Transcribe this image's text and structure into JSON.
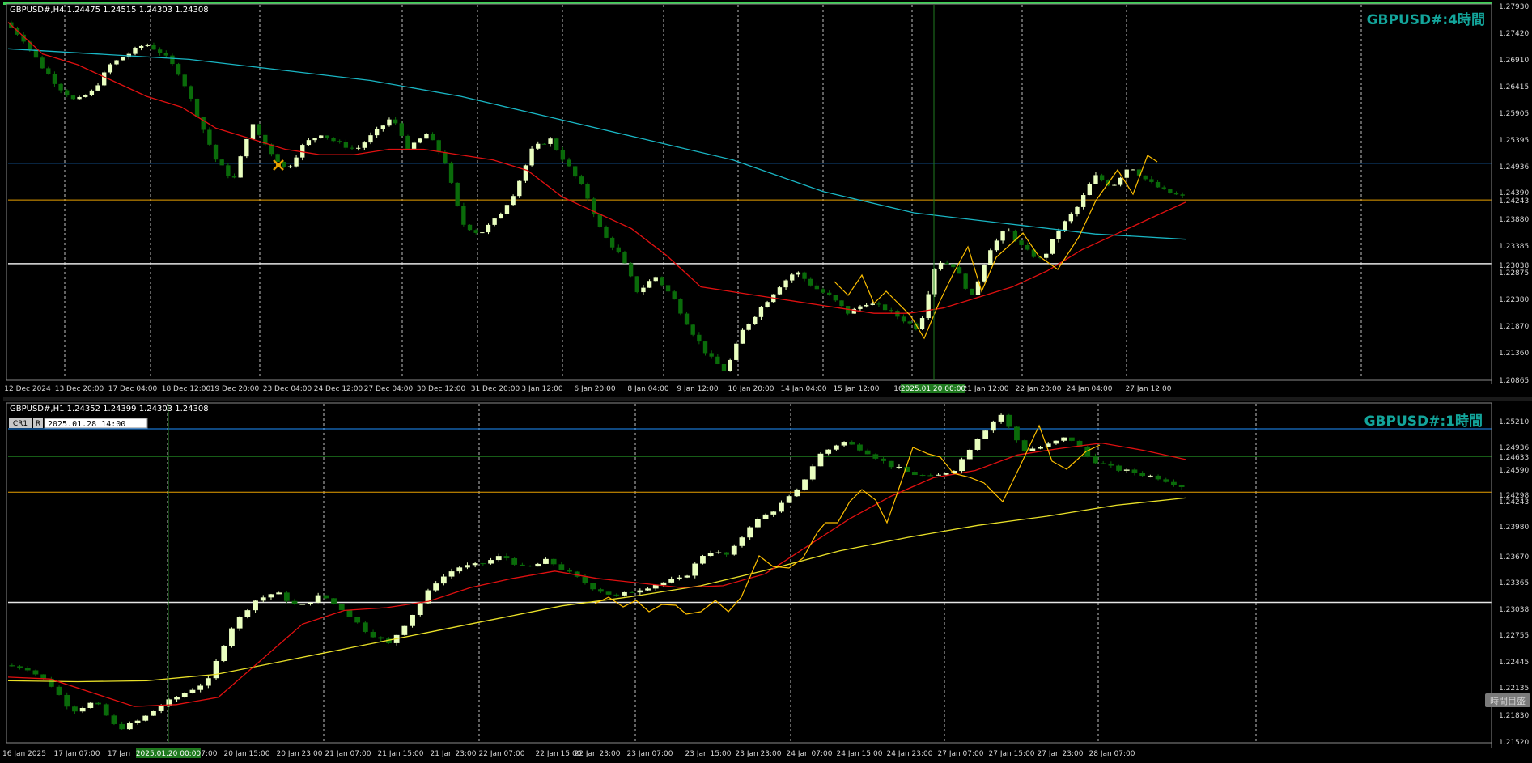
{
  "colors": {
    "background": "#000000",
    "frame": "#c0c0c0",
    "grid": "#c0c0c0",
    "bull_candle": "#eaffc0",
    "bear_candle": "#0a6b0a",
    "ma_short": "#e01010",
    "ma_long_h4": "#19b6c4",
    "ma_long_h1": "#e9e028",
    "zigzag": "#ffc000",
    "level_blue": "#1e90ff",
    "level_orange": "#e8a000",
    "level_white": "#e6e6e6",
    "level_green": "#1f7a1f",
    "watermark": "#13a59b",
    "top_bar": "#39d353"
  },
  "h4": {
    "info": "GBPUSD#,H4  1.24475 1.24515 1.24303 1.24308",
    "watermark": "GBPUSD#:4時間",
    "price_labels": [
      "1.27930",
      "1.27420",
      "1.26910",
      "1.26415",
      "1.25905",
      "1.25395",
      "1.24936",
      "1.24390",
      "1.24243",
      "1.23880",
      "1.23385",
      "1.23038",
      "1.22875",
      "1.22380",
      "1.21870",
      "1.21360",
      "1.20865"
    ],
    "date_labels": [
      "12 Dec 2024",
      "13 Dec 20:00",
      "17 Dec 04:00",
      "18 Dec 12:00",
      "19 Dec 20:00",
      "23 Dec 04:00",
      "24 Dec 12:00",
      "27 Dec 04:00",
      "30 Dec 12:00",
      "31 Dec 20:00",
      "3 Jan 12:00",
      "6 Jan 20:00",
      "8 Jan 04:00",
      "9 Jan 12:00",
      "10 Jan 20:00",
      "14 Jan 04:00",
      "15 Jan 12:00",
      "16",
      "04:00",
      "21 Jan 12:00",
      "22 Jan 20:00",
      "24 Jan 04:00",
      "27 Jan 12:00"
    ],
    "cursor_date": "2025.01.20 00:00",
    "level_blue": "1.24936",
    "level_orange": "1.24243",
    "level_white": "1.23038"
  },
  "h1": {
    "info": "GBPUSD#,H1  1.24352 1.24399 1.24303 1.24308",
    "watermark": "GBPUSD#:1時間",
    "tool_btn1": "CR1",
    "tool_btn2": "R",
    "date_input": "2025.01.28 14:00",
    "price_labels": [
      "1.25210",
      "1.24936",
      "1.24633",
      "1.24590",
      "1.24298",
      "1.24243",
      "1.23980",
      "1.23670",
      "1.23365",
      "1.23038",
      "1.22755",
      "1.22445",
      "1.22135",
      "1.21830",
      "1.21520"
    ],
    "date_labels": [
      "16 Jan 2025",
      "17 Jan 07:00",
      "17 Jan",
      "20 Jan 07:00",
      "20 Jan 15:00",
      "20 Jan 23:00",
      "21 Jan 07:00",
      "21 Jan 15:00",
      "21 Jan 23:00",
      "22 Jan 07:00",
      "22 Jan 15:00",
      "22 Jan 23:00",
      "23 Jan 07:00",
      "23 Jan 15:00",
      "23 Jan 23:00",
      "24 Jan 07:00",
      "24 Jan 15:00",
      "24 Jan 23:00",
      "27 Jan 07:00",
      "27 Jan 15:00",
      "27 Jan 23:00",
      "28 Jan 07:00"
    ],
    "cursor_date": "2025.01.20 00:00",
    "side_label": "時間目盛",
    "level_blue": "1.24936",
    "level_green": "1.24633",
    "level_orange": "1.24243",
    "level_white": "1.23038"
  },
  "chart_data": [
    {
      "type": "candlestick",
      "title": "GBPUSD#,H4",
      "ylim": [
        1.20865,
        1.2793
      ],
      "x_start": "12 Dec 2024",
      "x_end": "28 Jan 2025",
      "close_path": [
        1.276,
        1.273,
        1.268,
        1.264,
        1.261,
        1.263,
        1.268,
        1.27,
        1.272,
        1.27,
        1.266,
        1.258,
        1.25,
        1.246,
        1.257,
        1.252,
        1.248,
        1.253,
        1.255,
        1.253,
        1.252,
        1.255,
        1.258,
        1.252,
        1.255,
        1.25,
        1.238,
        1.236,
        1.239,
        1.244,
        1.252,
        1.254,
        1.249,
        1.244,
        1.236,
        1.232,
        1.225,
        1.228,
        1.224,
        1.218,
        1.213,
        1.21,
        1.218,
        1.222,
        1.226,
        1.229,
        1.226,
        1.224,
        1.221,
        1.223,
        1.222,
        1.22,
        1.218,
        1.231,
        1.23,
        1.224,
        1.233,
        1.237,
        1.233,
        1.231,
        1.237,
        1.241,
        1.247,
        1.245,
        1.249,
        1.246,
        1.244,
        1.243
      ],
      "ma_short_path": [
        1.276,
        1.27,
        1.268,
        1.265,
        1.262,
        1.26,
        1.256,
        1.254,
        1.252,
        1.251,
        1.251,
        1.252,
        1.252,
        1.251,
        1.25,
        1.248,
        1.243,
        1.24,
        1.237,
        1.232,
        1.226,
        1.225,
        1.224,
        1.223,
        1.222,
        1.221,
        1.221,
        1.222,
        1.224,
        1.226,
        1.229,
        1.233,
        1.236,
        1.239,
        1.242
      ],
      "ma_long_path": [
        1.271,
        1.27,
        1.269,
        1.267,
        1.265,
        1.262,
        1.258,
        1.254,
        1.25,
        1.244,
        1.24,
        1.238,
        1.236,
        1.235
      ],
      "levels": {
        "blue": 1.24936,
        "orange": 1.24243,
        "white": 1.23038
      }
    },
    {
      "type": "candlestick",
      "title": "GBPUSD#,H1",
      "ylim": [
        1.2152,
        1.2521
      ],
      "x_start": "16 Jan 2025",
      "x_end": "28 Jan 2025",
      "close_path": [
        1.2235,
        1.2232,
        1.2215,
        1.2185,
        1.2195,
        1.2165,
        1.2175,
        1.2192,
        1.2205,
        1.2218,
        1.2275,
        1.2305,
        1.2315,
        1.2298,
        1.2312,
        1.2295,
        1.2272,
        1.2258,
        1.229,
        1.2325,
        1.2342,
        1.2345,
        1.2355,
        1.234,
        1.235,
        1.2335,
        1.232,
        1.231,
        1.2318,
        1.2325,
        1.233,
        1.236,
        1.2355,
        1.239,
        1.2405,
        1.2425,
        1.2465,
        1.248,
        1.247,
        1.2455,
        1.2445,
        1.244,
        1.245,
        1.2485,
        1.251,
        1.247,
        1.2475,
        1.2485,
        1.246,
        1.245,
        1.2445,
        1.244,
        1.2431
      ],
      "ma_short_path": [
        1.2222,
        1.222,
        1.2205,
        1.219,
        1.2192,
        1.22,
        1.224,
        1.228,
        1.2295,
        1.2298,
        1.2305,
        1.232,
        1.233,
        1.2338,
        1.233,
        1.2325,
        1.232,
        1.2322,
        1.2335,
        1.2365,
        1.2395,
        1.242,
        1.244,
        1.2448,
        1.2465,
        1.2472,
        1.2478,
        1.247,
        1.246
      ],
      "ma_long_path": [
        1.2218,
        1.2217,
        1.2218,
        1.2225,
        1.224,
        1.2255,
        1.227,
        1.2285,
        1.23,
        1.231,
        1.2322,
        1.234,
        1.236,
        1.2375,
        1.2388,
        1.2398,
        1.241,
        1.2418
      ],
      "levels": {
        "blue": 1.24936,
        "green": 1.24633,
        "orange": 1.24243,
        "white": 1.23038
      }
    }
  ]
}
